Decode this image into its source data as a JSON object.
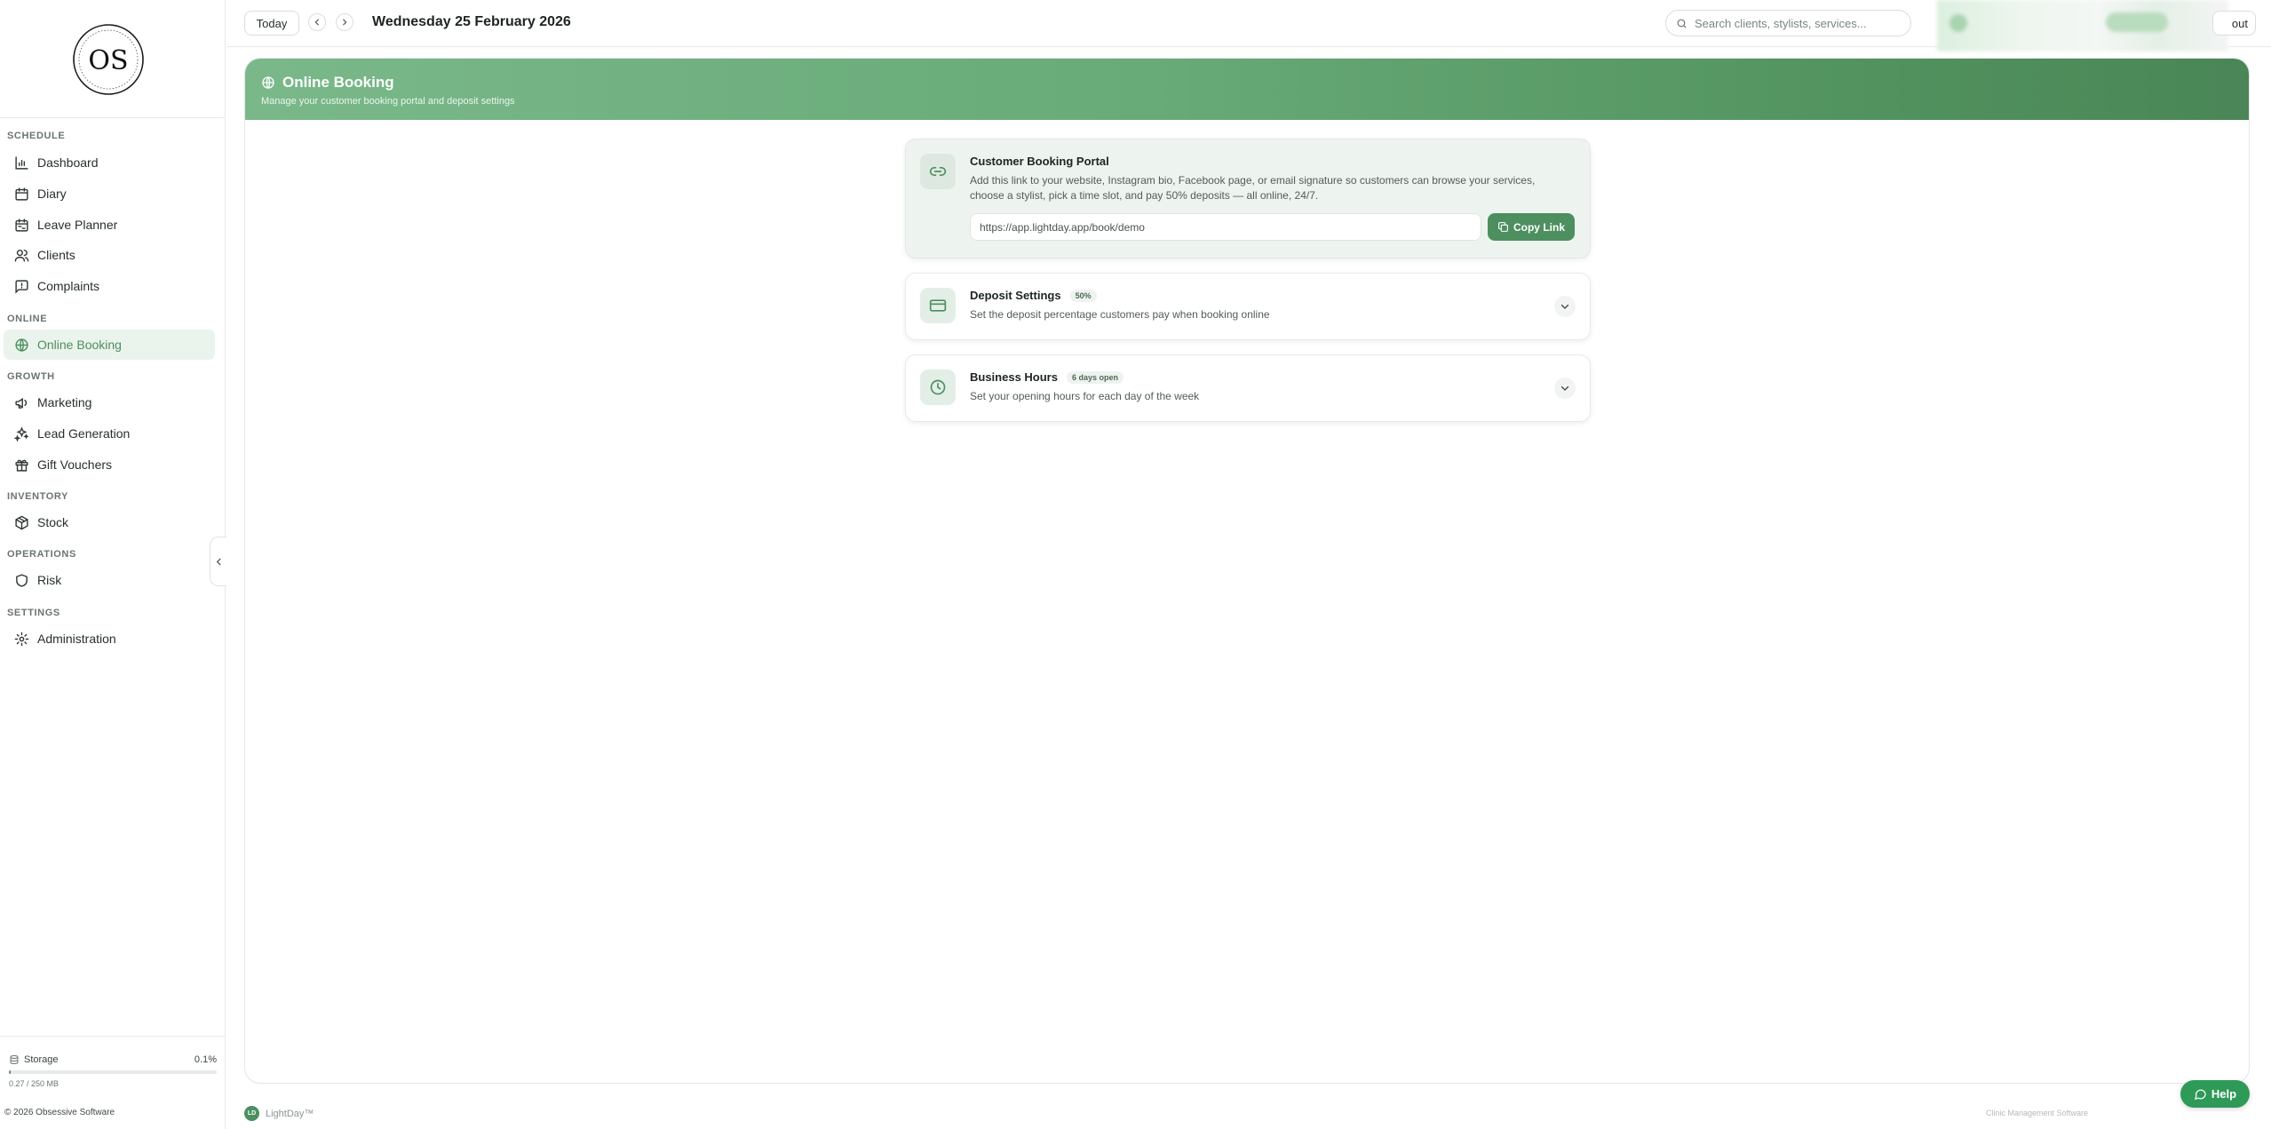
{
  "sidebar": {
    "logo_text": "OS",
    "sections": {
      "schedule": "SCHEDULE",
      "online": "ONLINE",
      "growth": "GROWTH",
      "inventory": "INVENTORY",
      "operations": "OPERATIONS",
      "settings": "SETTINGS"
    },
    "items": {
      "dashboard": "Dashboard",
      "diary": "Diary",
      "leave_planner": "Leave Planner",
      "clients": "Clients",
      "complaints": "Complaints",
      "online_booking": "Online Booking",
      "marketing": "Marketing",
      "lead_generation": "Lead Generation",
      "gift_vouchers": "Gift Vouchers",
      "stock": "Stock",
      "risk": "Risk",
      "administration": "Administration"
    },
    "active_item": "Online Booking",
    "storage": {
      "label": "Storage",
      "percent": "0.1%",
      "fill_fraction": 0.001,
      "size": "0.27 / 250 MB"
    },
    "copyright": "© 2026 Obsessive Software"
  },
  "topbar": {
    "today_label": "Today",
    "date": "Wednesday 25 February 2026",
    "search_placeholder": "Search clients, stylists, services...",
    "logout_label": "out"
  },
  "page": {
    "title": "Online Booking",
    "subtitle": "Manage your customer booking portal and deposit settings"
  },
  "cards": {
    "portal": {
      "title": "Customer Booking Portal",
      "description": "Add this link to your website, Instagram bio, Facebook page, or email signature so customers can browse your services, choose a stylist, pick a time slot, and pay 50% deposits — all online, 24/7.",
      "url": "https://app.lightday.app/book/demo",
      "copy_label": "Copy Link"
    },
    "deposit": {
      "title": "Deposit Settings",
      "badge": "50%",
      "description": "Set the deposit percentage customers pay when booking online"
    },
    "hours": {
      "title": "Business Hours",
      "badge": "6 days open",
      "description": "Set your opening hours for each day of the week"
    }
  },
  "footer": {
    "brand_mark": "LD",
    "brand": "LightDay™",
    "right_text": "Clinic Management Software",
    "help_label": "Help"
  },
  "colors": {
    "accent": "#4d8f5f",
    "banner_start": "#7ab88a",
    "banner_end": "#4a8657",
    "help": "#2f9a58"
  }
}
